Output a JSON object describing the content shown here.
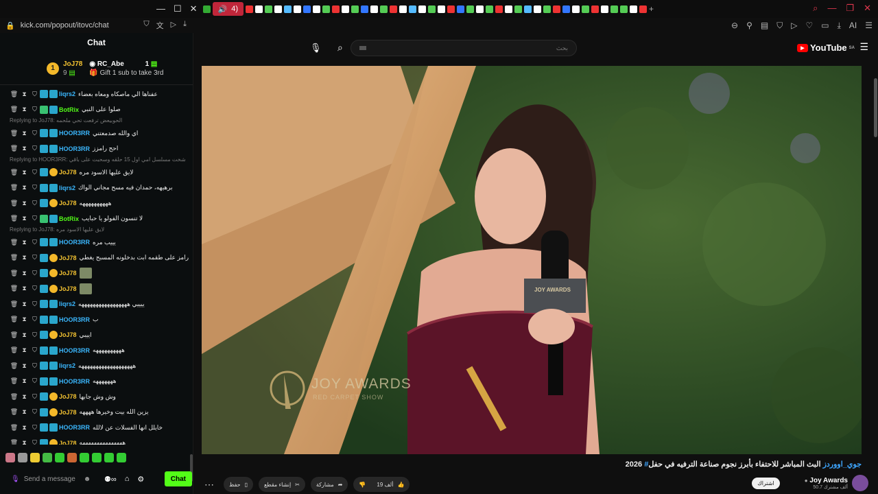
{
  "browser": {
    "address_url": "kick.com/popout/itovc/chat",
    "active_tab_label": "4)"
  },
  "chat": {
    "title": "Chat",
    "pinned": {
      "rank": "1",
      "user1": "JoJ78",
      "user1_count": "9",
      "user2": "RC_Abe",
      "user2_count": "1",
      "gift_text": "Gift 1 sub to take 3rd"
    },
    "send_placeholder": "Send a message",
    "send_button": "Chat",
    "messages": [
      {
        "user": "liqrs2",
        "text": "عفناها الي ماصكاه ومعاه بعضاء",
        "color": "#3bb8ff"
      },
      {
        "user": "BotRix",
        "text": "صلوا على النبي",
        "color": "#53fc18"
      },
      {
        "reply": "Replying to JoJ78: الحوبيعض ترفعت تحي ملحمه"
      },
      {
        "user": "HOOR3RR",
        "text": "اي والله صدمعتني",
        "color": "#3bb8ff"
      },
      {
        "user": "HOOR3RR",
        "text": "احح رامزز",
        "color": "#3bb8ff"
      },
      {
        "reply": "Replying to HOOR3RR: شخت مسلسل امي اول 15 حلقه وسحبت على باقي"
      },
      {
        "user": "JoJ78",
        "text": "لايق عليها الاسود مره",
        "color": "#f3c231"
      },
      {
        "user": "liqrs2",
        "text": "برهيهه، حمدان فيه مسح مجاني الواك",
        "color": "#3bb8ff"
      },
      {
        "user": "JoJ78",
        "text": "ههههههههههه",
        "color": "#f3c231"
      },
      {
        "user": "BotRix",
        "text": "لا تنسون الفولو يا حبايب",
        "color": "#53fc18"
      },
      {
        "reply": "Replying to JoJ78: لايق عليها الاسود مره"
      },
      {
        "user": "HOOR3RR",
        "text": "يييب مره",
        "color": "#3bb8ff"
      },
      {
        "user": "JoJ78",
        "text": "رامز على طقمه ابت بدخلونه المسبح يغطي",
        "color": "#f3c231"
      },
      {
        "user": "JoJ78",
        "text": "",
        "color": "#f3c231"
      },
      {
        "user": "JoJ78",
        "text": "",
        "color": "#f3c231"
      },
      {
        "user": "liqrs2",
        "text": "ييييي هههههههههههههههههه",
        "color": "#3bb8ff"
      },
      {
        "user": "HOOR3RR",
        "text": "ب",
        "color": "#3bb8ff"
      },
      {
        "user": "JoJ78",
        "text": "اييبي",
        "color": "#f3c231"
      },
      {
        "user": "HOOR3RR",
        "text": "ههههههههههه",
        "color": "#3bb8ff"
      },
      {
        "user": "liqrs2",
        "text": "هههههههههههههههههههه",
        "color": "#3bb8ff"
      },
      {
        "user": "HOOR3RR",
        "text": "هههههههه",
        "color": "#3bb8ff"
      },
      {
        "user": "JoJ78",
        "text": "وش وش جابها",
        "color": "#f3c231"
      },
      {
        "user": "JoJ78",
        "text": "يزين الله بيت وخيرها ههههه",
        "color": "#f3c231"
      },
      {
        "user": "HOOR3RR",
        "text": "خايلل انها الفسلات عن لالله",
        "color": "#3bb8ff"
      },
      {
        "user": "JoJ78",
        "text": "هههههههههههههههه",
        "color": "#f3c231"
      }
    ]
  },
  "youtube": {
    "search_placeholder": "بحث",
    "logo_text": "YouTube",
    "logo_region": "SA",
    "video_title": "البث المباشر للاحتفاء بأبرز نجوم صناعة الترفيه في حفل",
    "video_title_tag": "#جوي_اووردز",
    "video_title_year": "2026",
    "overlay_logo": "JOY AWARDS",
    "overlay_sub": "RED CARPET SHOW",
    "mic_flag_text": "JOY AWARDS",
    "actions": {
      "like_count": "19 ألف",
      "share": "مشاركة",
      "clip": "إنشاء مقطع",
      "save": "حفظ"
    },
    "channel_name": "Joy Awards",
    "channel_subs": "50.7 ألف مشترك",
    "subscribe": "اشتراك"
  }
}
